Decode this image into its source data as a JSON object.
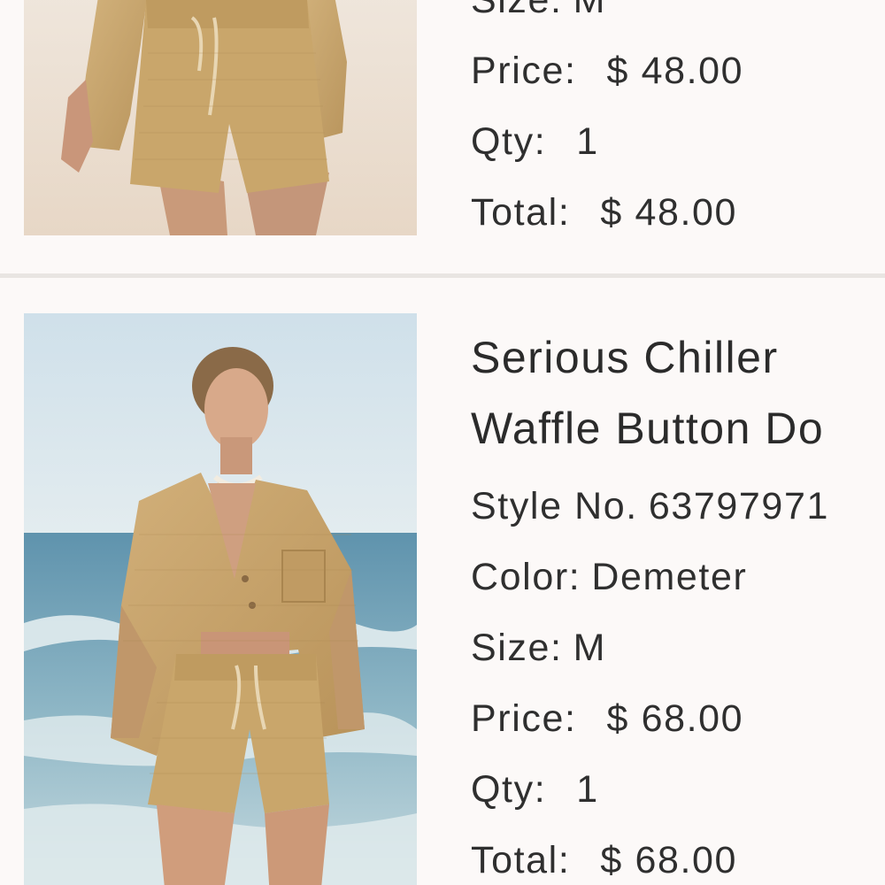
{
  "cart_items": [
    {
      "size_label": "Size:",
      "size_value": "M",
      "price_label": "Price:",
      "price_value": "$ 48.00",
      "qty_label": "Qty:",
      "qty_value": "1",
      "total_label": "Total:",
      "total_value": "$ 48.00"
    },
    {
      "title_line1": "Serious Chiller",
      "title_line2": "Waffle Button Do",
      "style_label": "Style No.",
      "style_value": "63797971",
      "color_label": "Color:",
      "color_value": "Demeter",
      "size_label": "Size:",
      "size_value": "M",
      "price_label": "Price:",
      "price_value": "$ 68.00",
      "qty_label": "Qty:",
      "qty_value": "1",
      "total_label": "Total:",
      "total_value": "$ 68.00"
    }
  ],
  "colors": {
    "background": "#fcf9f8",
    "divider": "#e9e5e2",
    "text": "#2b2b2b",
    "garment": "#c9a66b"
  }
}
